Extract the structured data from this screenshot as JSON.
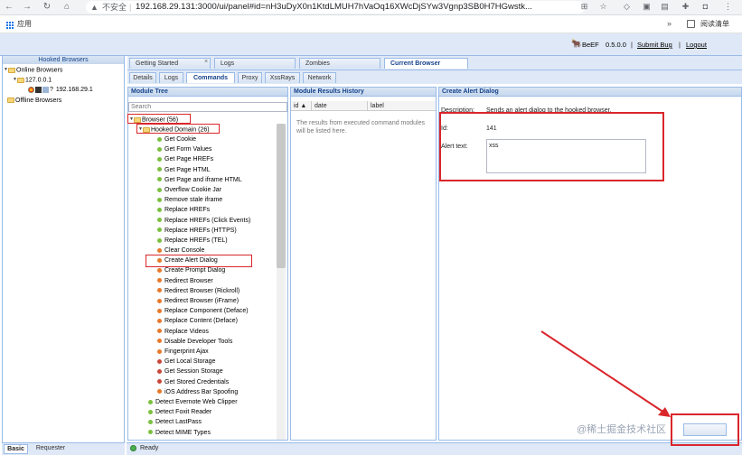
{
  "browser": {
    "security_label": "不安全",
    "url": "192.168.29.131:3000/ui/panel#id=nH3uDyX0n1KtdLMUH7hVaOq16XWcDjSYw3Vgnp3SB0H7HGwstk...",
    "bookmarks_apps_label": "应用",
    "bookmarks_more": "»",
    "reading_list_label": "阅读清单"
  },
  "header": {
    "app_name": "BeEF",
    "version": "0.5.0.0",
    "separator": "|",
    "submit_bug": "Submit Bug",
    "logout": "Logout"
  },
  "hooked_browsers": {
    "title": "Hooked Browsers",
    "online_label": "Online Browsers",
    "host_ip": "127.0.0.1",
    "browser_ip": "192.168.29.1",
    "browser_icon_q": "?",
    "offline_label": "Offline Browsers"
  },
  "left_tabs": {
    "basic": "Basic",
    "requester": "Requester"
  },
  "main_tabs": [
    "Getting Started",
    "Logs",
    "Zombies",
    "Current Browser"
  ],
  "sub_tabs": [
    "Details",
    "Logs",
    "Commands",
    "Proxy",
    "XssRays",
    "Network"
  ],
  "module_tree": {
    "title": "Module Tree",
    "search_placeholder": "Search",
    "browser_node": "Browser (56)",
    "hooked_domain_node": "Hooked Domain (26)",
    "modules": [
      {
        "label": "Get Cookie",
        "color": "#7cbf3f"
      },
      {
        "label": "Get Form Values",
        "color": "#7cbf3f"
      },
      {
        "label": "Get Page HREFs",
        "color": "#7cbf3f"
      },
      {
        "label": "Get Page HTML",
        "color": "#7cbf3f"
      },
      {
        "label": "Get Page and iframe HTML",
        "color": "#7cbf3f"
      },
      {
        "label": "Overflow Cookie Jar",
        "color": "#7cbf3f"
      },
      {
        "label": "Remove stale iframe",
        "color": "#7cbf3f"
      },
      {
        "label": "Replace HREFs",
        "color": "#7cbf3f"
      },
      {
        "label": "Replace HREFs (Click Events)",
        "color": "#7cbf3f"
      },
      {
        "label": "Replace HREFs (HTTPS)",
        "color": "#7cbf3f"
      },
      {
        "label": "Replace HREFs (TEL)",
        "color": "#7cbf3f"
      },
      {
        "label": "Clear Console",
        "color": "#e8782a"
      },
      {
        "label": "Create Alert Dialog",
        "color": "#e8782a"
      },
      {
        "label": "Create Prompt Dialog",
        "color": "#e8782a"
      },
      {
        "label": "Redirect Browser",
        "color": "#e8782a"
      },
      {
        "label": "Redirect Browser (Rickroll)",
        "color": "#e8782a"
      },
      {
        "label": "Redirect Browser (iFrame)",
        "color": "#e8782a"
      },
      {
        "label": "Replace Component (Deface)",
        "color": "#e8782a"
      },
      {
        "label": "Replace Content (Deface)",
        "color": "#e8782a"
      },
      {
        "label": "Replace Videos",
        "color": "#e8782a"
      },
      {
        "label": "Disable Developer Tools",
        "color": "#e8782a"
      },
      {
        "label": "Fingerprint Ajax",
        "color": "#e8782a"
      },
      {
        "label": "Get Local Storage",
        "color": "#c9473a"
      },
      {
        "label": "Get Session Storage",
        "color": "#c9473a"
      },
      {
        "label": "Get Stored Credentials",
        "color": "#c9473a"
      },
      {
        "label": "iOS Address Bar Spoofing",
        "color": "#e8782a"
      }
    ],
    "browser_modules": [
      {
        "label": "Detect Evernote Web Clipper",
        "color": "#7cbf3f"
      },
      {
        "label": "Detect Foxit Reader",
        "color": "#7cbf3f"
      },
      {
        "label": "Detect LastPass",
        "color": "#7cbf3f"
      },
      {
        "label": "Detect MIME Types",
        "color": "#7cbf3f"
      }
    ]
  },
  "results": {
    "title": "Module Results History",
    "columns": [
      "id",
      "date",
      "label"
    ],
    "empty_text": "The results from executed command modules will be listed here."
  },
  "alert_dialog": {
    "title": "Create Alert Dialog",
    "description_label": "Description:",
    "description": "Sends an alert dialog to the hooked browser.",
    "id_label": "Id:",
    "id_value": "141",
    "alert_text_label": "Alert text:",
    "alert_text_value": "xss"
  },
  "status": {
    "ready": "Ready"
  },
  "watermark": "@稀土掘金技术社区",
  "highlight_color": "#d9262b"
}
